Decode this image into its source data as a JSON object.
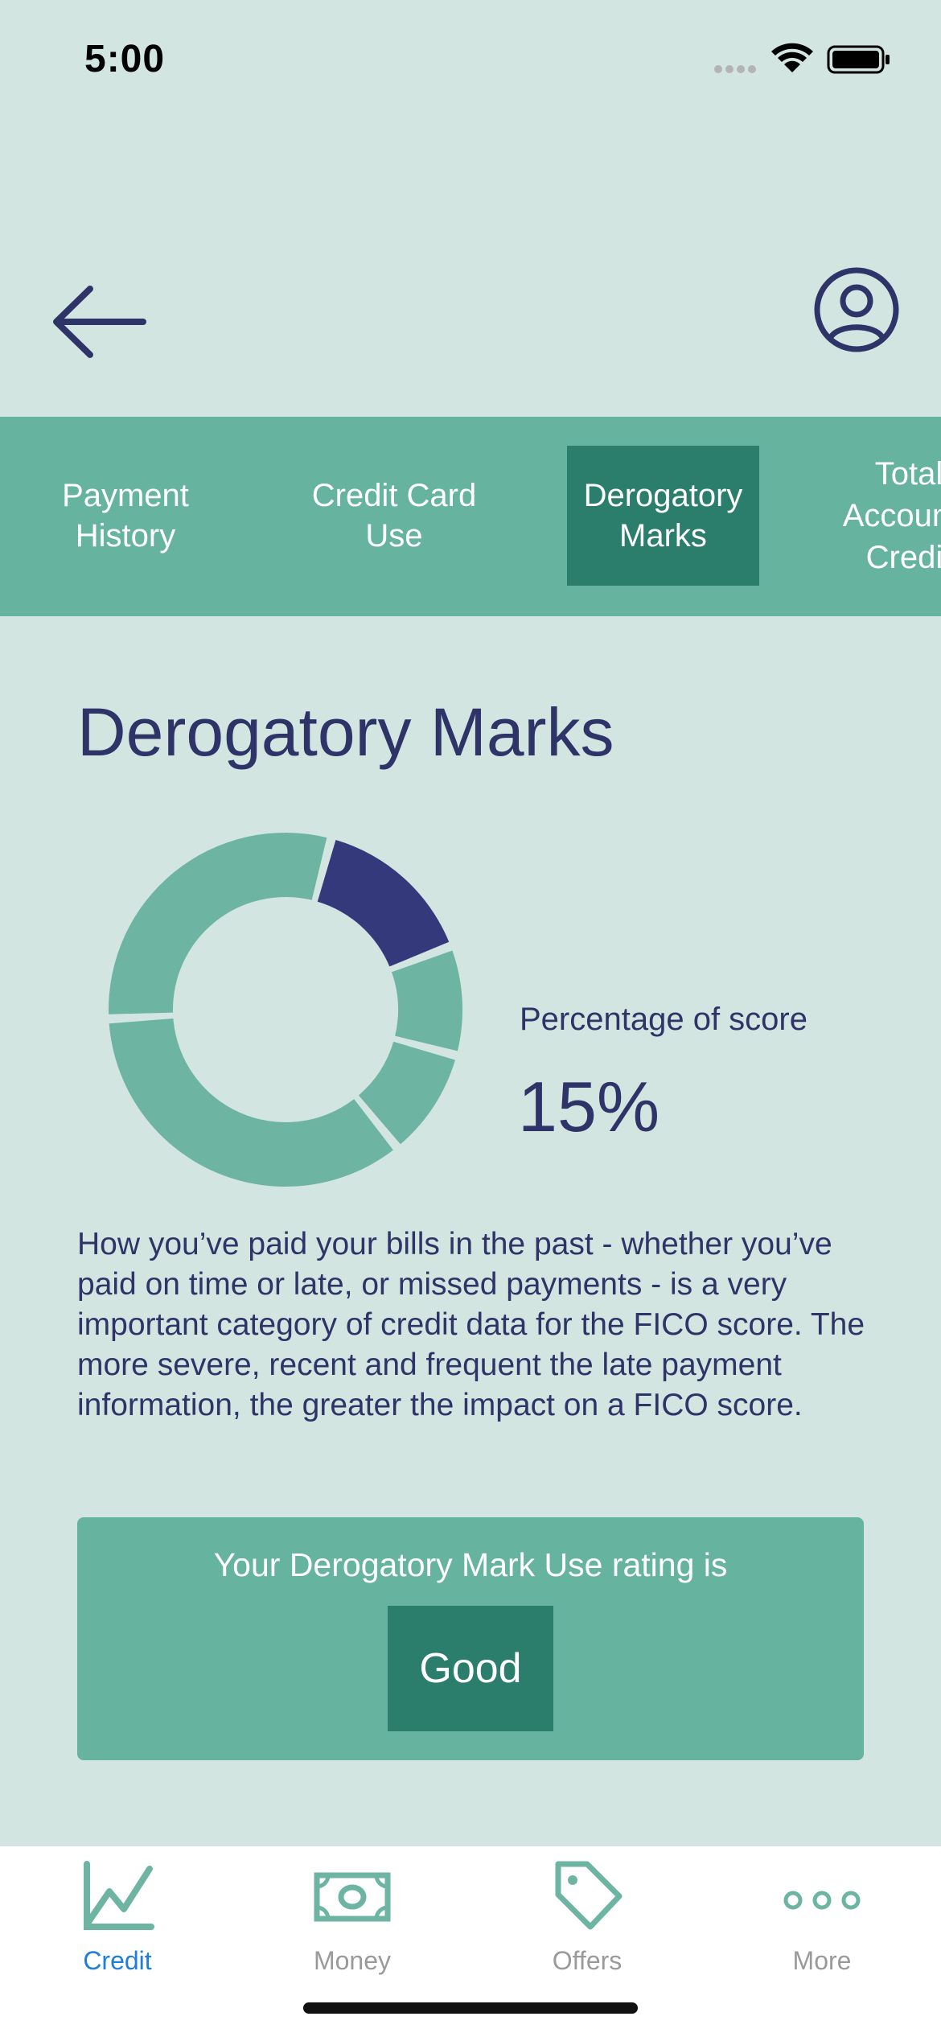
{
  "status_bar": {
    "time": "5:00",
    "icons": [
      "signal-icon",
      "wifi-icon",
      "battery-icon"
    ]
  },
  "header": {
    "back_icon": "arrow-left-icon",
    "profile_icon": "user-circle-icon"
  },
  "tabs": [
    {
      "label": "Payment\nHistory",
      "active": false
    },
    {
      "label": "Credit Card\nUse",
      "active": false
    },
    {
      "label": "Derogatory\nMarks",
      "active": true
    },
    {
      "label": "Total\nAccounts\nCredit",
      "active": false
    }
  ],
  "section": {
    "title": "Derogatory Marks",
    "percentage_label": "Percentage of score",
    "percentage_value": "15%",
    "description": "How you’ve paid your bills in the past - whether you’ve paid on time or late, or missed payments - is a very important category of credit data for the FICO score. The more severe, recent and frequent the late payment information, the greater the impact on a FICO score."
  },
  "donut": {
    "segments": [
      {
        "value": 15,
        "highlight": true
      },
      {
        "value": 10,
        "highlight": false
      },
      {
        "value": 10,
        "highlight": false
      },
      {
        "value": 35,
        "highlight": false
      },
      {
        "value": 30,
        "highlight": false
      }
    ],
    "highlight_color": "#33397a",
    "base_color": "#6db5a2"
  },
  "rating": {
    "text": "Your Derogatory Mark Use rating is",
    "value": "Good"
  },
  "bottom_nav": [
    {
      "label": "Credit",
      "icon": "chart-line-icon",
      "active": true
    },
    {
      "label": "Money",
      "icon": "banknote-icon",
      "active": false
    },
    {
      "label": "Offers",
      "icon": "tag-icon",
      "active": false
    },
    {
      "label": "More",
      "icon": "more-dots-icon",
      "active": false
    }
  ],
  "colors": {
    "background": "#d3e5e0",
    "primary_text": "#2e3468",
    "tab_bar": "#66b39f",
    "tab_active": "#2b7e6b",
    "nav_active": "#1f7fd8",
    "nav_inactive": "#9a9a9a"
  }
}
